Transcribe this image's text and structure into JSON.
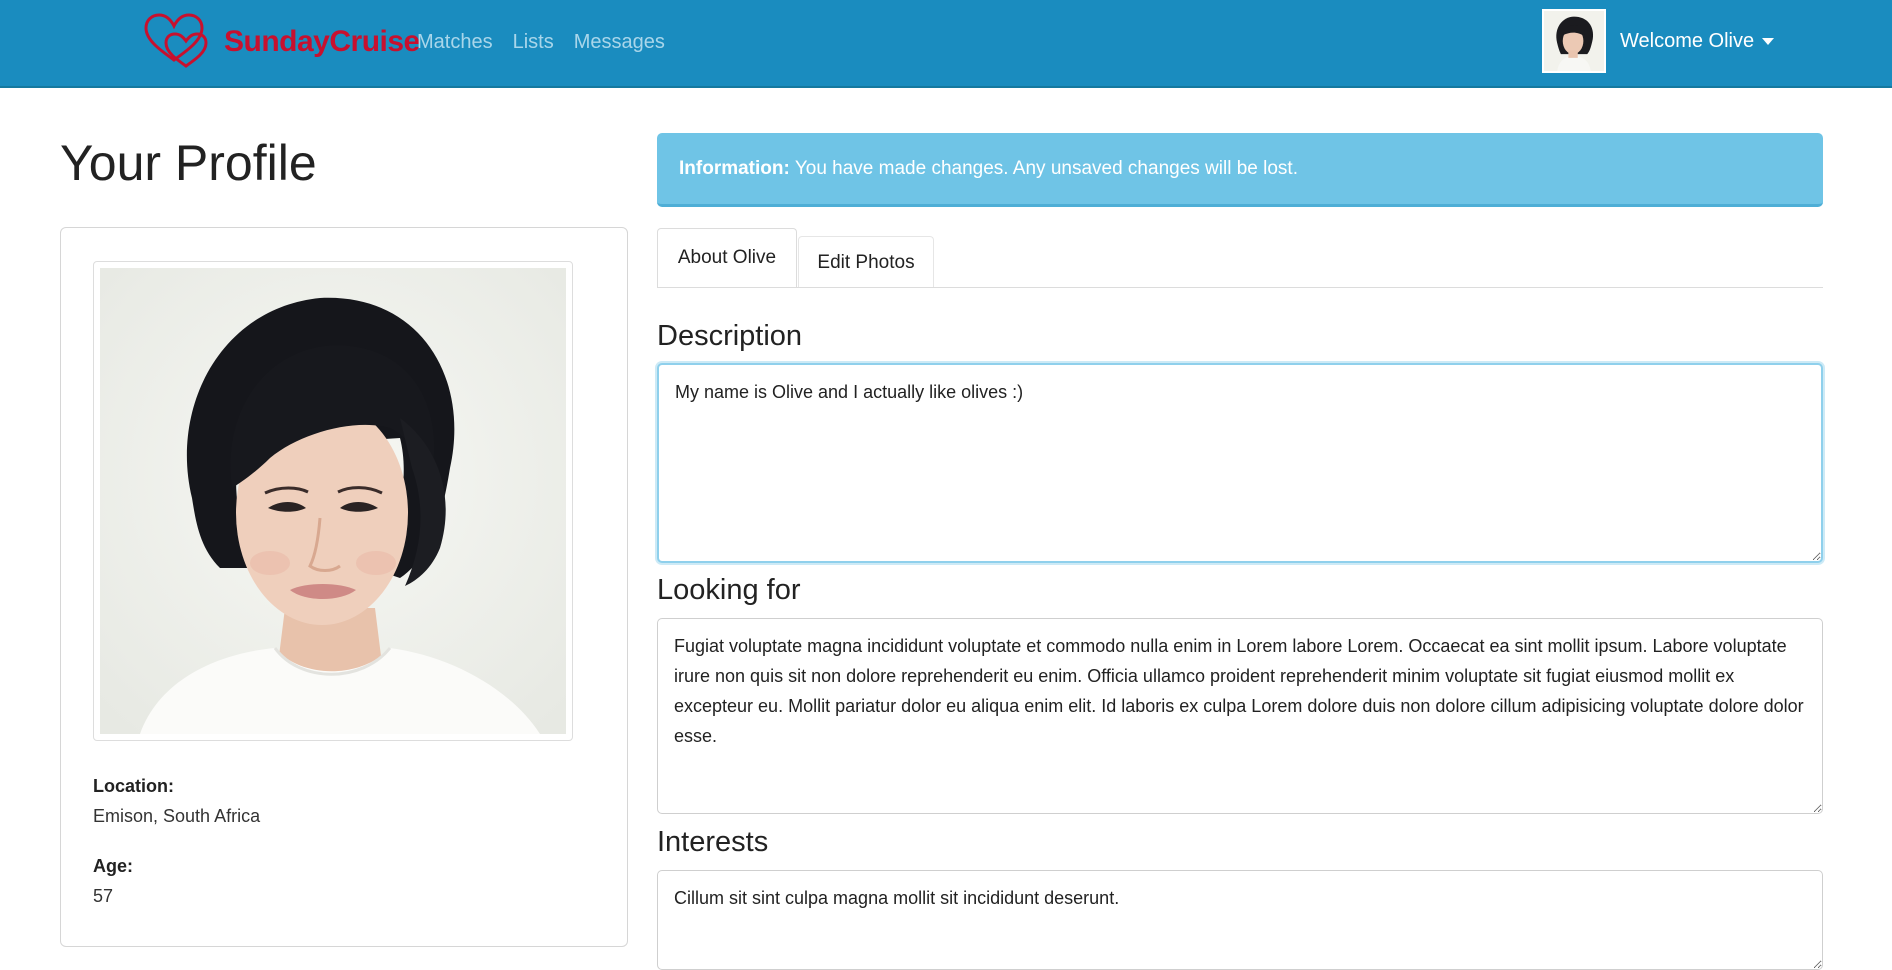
{
  "navbar": {
    "brand": "SundayCruise",
    "links": [
      "Matches",
      "Lists",
      "Messages"
    ],
    "welcome": "Welcome Olive",
    "brand_color": "#c8102e",
    "bg_color": "#1a8cbf"
  },
  "page": {
    "title": "Your Profile"
  },
  "profile": {
    "location_label": "Location:",
    "location_value": "Emison, South Africa",
    "age_label": "Age:",
    "age_value": "57"
  },
  "alert": {
    "strong": "Information:",
    "text": "You have made changes. Any unsaved changes will be lost."
  },
  "tabs": [
    {
      "label": "About Olive",
      "active": true
    },
    {
      "label": "Edit Photos",
      "active": false
    }
  ],
  "sections": {
    "description": {
      "heading": "Description",
      "value": "My name is Olive and I actually like olives :)"
    },
    "looking_for": {
      "heading": "Looking for",
      "value": "Fugiat voluptate magna incididunt voluptate et commodo nulla enim in Lorem labore Lorem. Occaecat ea sint mollit ipsum. Labore voluptate irure non quis sit non dolore reprehenderit eu enim. Officia ullamco proident reprehenderit minim voluptate sit fugiat eiusmod mollit ex excepteur eu. Mollit pariatur dolor eu aliqua enim elit. Id laboris ex culpa Lorem dolore duis non dolore cillum adipisicing voluptate dolore dolor esse."
    },
    "interests": {
      "heading": "Interests",
      "value": "Cillum sit sint culpa magna mollit sit incididunt deserunt."
    }
  },
  "icons": {
    "brand_logo": "two-hearts-icon",
    "caret": "caret-down-icon"
  }
}
